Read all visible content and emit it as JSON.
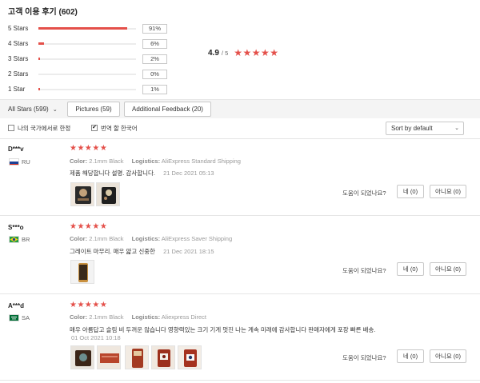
{
  "title": "고객 이용 후기 (602)",
  "rating_breakdown": [
    {
      "label": "5 Stars",
      "percent_text": "91%",
      "fraction": 0.91
    },
    {
      "label": "4 Stars",
      "percent_text": "6%",
      "fraction": 0.06
    },
    {
      "label": "3 Stars",
      "percent_text": "2%",
      "fraction": 0.02
    },
    {
      "label": "2 Stars",
      "percent_text": "0%",
      "fraction": 0.0
    },
    {
      "label": "1 Star",
      "percent_text": "1%",
      "fraction": 0.01
    }
  ],
  "summary": {
    "average": "4.9",
    "of": "/ 5",
    "stars": "★★★★★"
  },
  "filters": {
    "all_stars": "All Stars (599)",
    "all_stars_chevron": "⌄",
    "pictures": "Pictures (59)",
    "additional_feedback": "Additional Feedback (20)"
  },
  "options": {
    "my_country_only": "나의 국가에서로 한정",
    "translate_korean": "번역 할 한국어",
    "translate_checked_mark": "✔",
    "sort": "Sort by default",
    "sort_chevron": "⌄"
  },
  "labels": {
    "color": "Color:",
    "logistics": "Logistics:",
    "helpful": "도움이 되었나요?"
  },
  "reviews": [
    {
      "name": "D***v",
      "country": "RU",
      "stars": "★★★★★",
      "color": "2.1mm Black",
      "logistics": "AliExpress Standard Shipping",
      "text": "제품 해당합니다 설명. 감사합니다.",
      "date": "21 Dec 2021 05:13",
      "yes": "네 (0)",
      "no": "아니요 (0)"
    },
    {
      "name": "S***o",
      "country": "BR",
      "stars": "★★★★★",
      "color": "2.1mm Black",
      "logistics": "AliExpress Saver Shipping",
      "text": "그레이트 마무리. 매우 얇고 신중한",
      "date": "21 Dec 2021 18:15",
      "yes": "네 (0)",
      "no": "아니요 (0)"
    },
    {
      "name": "A***d",
      "country": "SA",
      "stars": "★★★★★",
      "color": "2.1mm Black",
      "logistics": "Aliexpress Direct",
      "text": "매우 아름답고 슬림 비 두꺼운 않습니다 영향력있는 크기 기게 멋진 나는 계속 미래에 감사합니다 판매자에게 포장 빠른 배송.",
      "date": "01 Oct 2021 10:18",
      "yes": "네 (0)",
      "no": "아니요 (0)"
    }
  ],
  "colors": {
    "accent": "#e4504a",
    "flag_ru": [
      "#ffffff",
      "#1c3f94",
      "#d52b1e"
    ],
    "flag_br": "#229e45",
    "flag_sa": "#006c35"
  }
}
